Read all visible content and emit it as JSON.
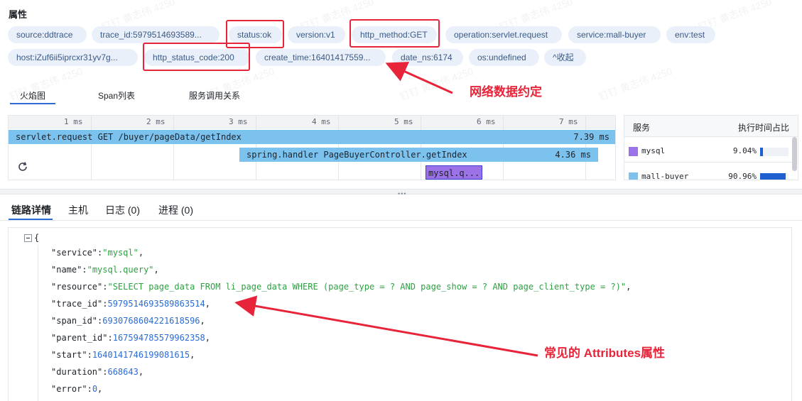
{
  "attributes": {
    "title": "属性",
    "tags": [
      "source:ddtrace",
      "trace_id:5979514693589...",
      "status:ok",
      "version:v1",
      "http_method:GET",
      "operation:servlet.request",
      "service:mall-buyer",
      "env:test",
      "host:iZuf6ii5iprcxr31yv7g...",
      "http_status_code:200",
      "create_time:16401417559...",
      "date_ns:6174",
      "os:undefined"
    ],
    "collapse_label": "收起"
  },
  "view_tabs": [
    "火焰图",
    "Span列表",
    "服务调用关系"
  ],
  "flame": {
    "ticks": [
      "1 ms",
      "2 ms",
      "3 ms",
      "4 ms",
      "5 ms",
      "6 ms",
      "7 ms"
    ],
    "spans": [
      {
        "label": "servlet.request GET /buyer/pageData/getIndex",
        "duration": "7.39 ms"
      },
      {
        "label": "spring.handler PageBuyerController.getIndex",
        "duration": "4.36 ms"
      },
      {
        "label": "mysql.q...",
        "duration": ""
      }
    ]
  },
  "service_table": {
    "header_service": "服务",
    "header_ratio": "执行时间占比",
    "rows": [
      {
        "name": "mysql",
        "percent": "9.04%",
        "fraction": 0.0904,
        "color": "#9b72e8"
      },
      {
        "name": "mall-buyer",
        "percent": "90.96%",
        "fraction": 0.9096,
        "color": "#7cc2ef"
      }
    ]
  },
  "detail_tabs": [
    "链路详情",
    "主机",
    "日志 (0)",
    "进程 (0)"
  ],
  "json_lines": [
    {
      "key": "\"service\"",
      "value": "\"mysql\"",
      "type": "str"
    },
    {
      "key": "\"name\"",
      "value": "\"mysql.query\"",
      "type": "str"
    },
    {
      "key": "\"resource\"",
      "value": "\"SELECT page_data FROM li_page_data WHERE (page_type = ? AND page_show = ? AND page_client_type = ?)\"",
      "type": "str"
    },
    {
      "key": "\"trace_id\"",
      "value": "5979514693589863514",
      "type": "num"
    },
    {
      "key": "\"span_id\"",
      "value": "6930768604221618596",
      "type": "num"
    },
    {
      "key": "\"parent_id\"",
      "value": "167594785579962358",
      "type": "num"
    },
    {
      "key": "\"start\"",
      "value": "1640141746199081615",
      "type": "num"
    },
    {
      "key": "\"duration\"",
      "value": "668643",
      "type": "num"
    },
    {
      "key": "\"error\"",
      "value": "0",
      "type": "num"
    }
  ],
  "json_open": "{",
  "annotations": {
    "network": "网络数据约定",
    "attributes": "常见的 Attributes属性"
  },
  "watermark": "钉钉 黄志伟 4250",
  "colors": {
    "tag_bg": "#eaf0f9",
    "accent": "#2a6bd6",
    "annotation": "#e8243a",
    "root_span": "#7cc2ef",
    "mysql_span": "#9b72e8"
  }
}
